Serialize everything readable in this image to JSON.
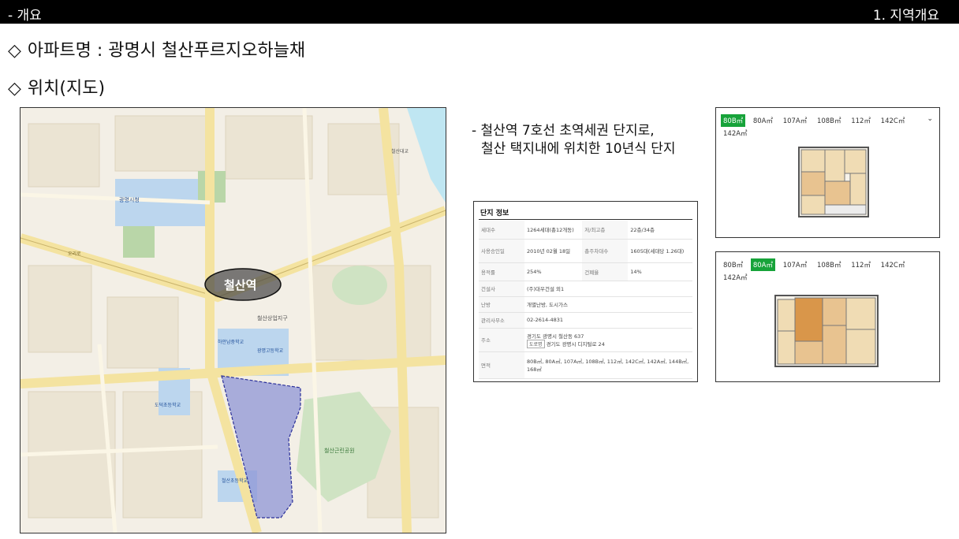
{
  "header": {
    "left": "- 개요",
    "right": "1. 지역개요"
  },
  "headings": {
    "diamond": "◇",
    "apartment": "아파트명 : 광명시 철산푸르지오하늘채",
    "location": "위치(지도)"
  },
  "map": {
    "station_label": "철산역",
    "labels": [
      "광명시청",
      "철산역",
      "철산상업지구",
      "도덕초등학교",
      "철산초등학교",
      "광명고등학교",
      "하안남중학교",
      "철산근린공원",
      "철산대교",
      "오리로"
    ],
    "colors": {
      "road": "#f4e3a0",
      "park": "#cfe3c3",
      "complex": "#8f96d6",
      "school": "#bcd6ee",
      "river": "#bfe6f2"
    }
  },
  "description": {
    "line1": "- 철산역 7호선 초역세권 단지로,",
    "line2": "철산 택지내에 위치한 10년식 단지"
  },
  "info": {
    "title": "단지 정보",
    "rows": [
      {
        "k1": "세대수",
        "v1": "1264세대(총12개동)",
        "k2": "저/최고층",
        "v2": "22층/34층"
      },
      {
        "k1": "사용승인일",
        "v1": "2010년 02월 18일",
        "k2": "총주차대수",
        "v2": "1605대(세대당 1.26대)"
      },
      {
        "k1": "용적률",
        "v1": "254%",
        "k2": "건폐율",
        "v2": "14%"
      },
      {
        "k1": "건설사",
        "v1": "(주)대우건설 외1"
      },
      {
        "k1": "난방",
        "v1": "개별난방, 도시가스"
      },
      {
        "k1": "관리사무소",
        "v1": "02-2614-4831"
      },
      {
        "k1": "주소",
        "v1": "경기도 광명시 철산동 637",
        "tag": "도로명",
        "v1b": "경기도 광명시 디지털로 24"
      },
      {
        "k1": "면적",
        "v1": "80B㎡, 80A㎡, 107A㎡, 108B㎡, 112㎡, 142C㎡, 142A㎡, 144B㎡, 168㎡"
      }
    ]
  },
  "plans": {
    "tabs": [
      "80B㎡",
      "80A㎡",
      "107A㎡",
      "108B㎡",
      "112㎡",
      "142C㎡",
      "142A㎡"
    ],
    "chevron": "⌄",
    "active_top": "80B㎡",
    "active_bottom": "80A㎡"
  }
}
